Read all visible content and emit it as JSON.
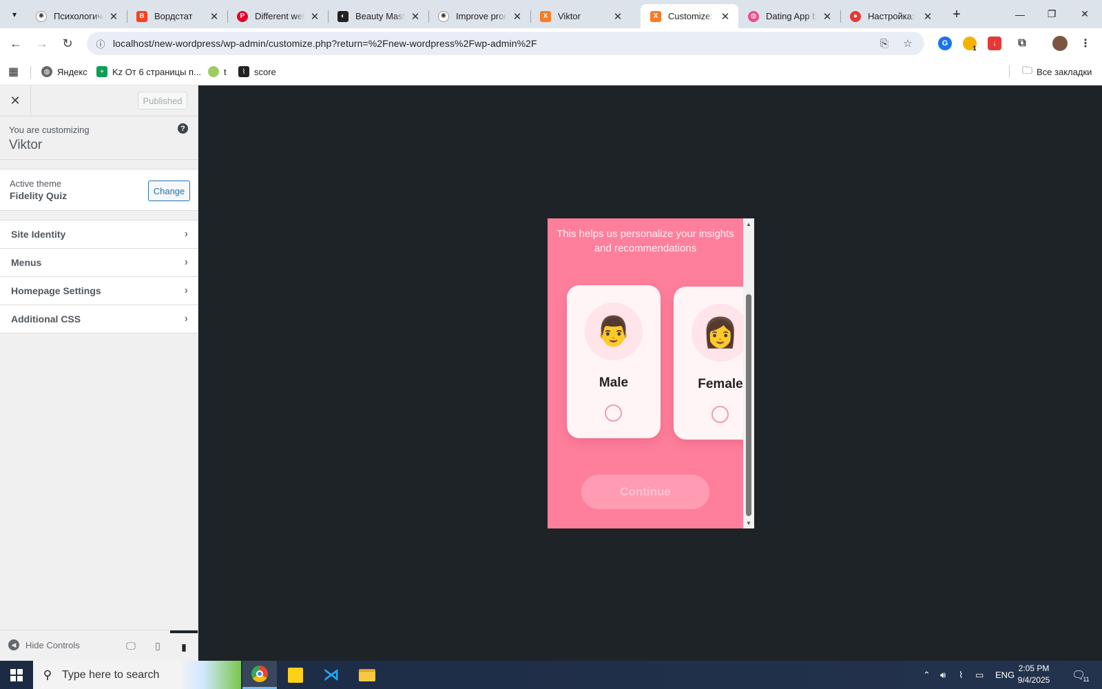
{
  "browser": {
    "tabs": [
      {
        "title": "Психологиче",
        "favicon": "openai-icon",
        "active": false
      },
      {
        "title": "Вордстат",
        "favicon": "wordstat-icon",
        "active": false
      },
      {
        "title": "Different web",
        "favicon": "pinterest-icon",
        "active": false
      },
      {
        "title": "Beauty Maste",
        "favicon": "app-icon",
        "active": false
      },
      {
        "title": "Improve pron",
        "favicon": "openai-icon",
        "active": false
      },
      {
        "title": "Viktor",
        "favicon": "xampp-icon",
        "active": false
      },
      {
        "title": "Customize: V",
        "favicon": "xampp-icon",
        "active": true
      },
      {
        "title": "Dating App b",
        "favicon": "dribbble-icon",
        "active": false
      },
      {
        "title": "Настройка: S",
        "favicon": "record-icon",
        "active": false
      }
    ],
    "url": "localhost/new-wordpress/wp-admin/customize.php?return=%2Fnew-wordpress%2Fwp-admin%2F",
    "extension_badge": "1",
    "bookmarks": [
      {
        "label": "Яндекс"
      },
      {
        "label": "Kz От 6 страницы п..."
      },
      {
        "label": "t"
      },
      {
        "label": "score"
      }
    ],
    "all_bookmarks": "Все закладки"
  },
  "customizer": {
    "publish_label": "Published",
    "customizing_label": "You are customizing",
    "site_name": "Viktor",
    "active_theme_label": "Active theme",
    "theme_name": "Fidelity Quiz",
    "change_label": "Change",
    "sections": [
      {
        "label": "Site Identity"
      },
      {
        "label": "Menus"
      },
      {
        "label": "Homepage Settings"
      },
      {
        "label": "Additional CSS"
      }
    ],
    "hide_controls": "Hide Controls"
  },
  "preview": {
    "subtitle": "This helps us personalize your insights and recommendations",
    "options": [
      {
        "label": "Male",
        "emoji": "👨"
      },
      {
        "label": "Female",
        "emoji": "👩"
      }
    ],
    "continue_label": "Continue",
    "colors": {
      "background": "#fe7f9c",
      "card": "#fff5f7"
    }
  },
  "taskbar": {
    "search_placeholder": "Type here to search",
    "language": "ENG",
    "time": "2:05 PM",
    "date": "9/4/2025",
    "notifications": "11"
  }
}
